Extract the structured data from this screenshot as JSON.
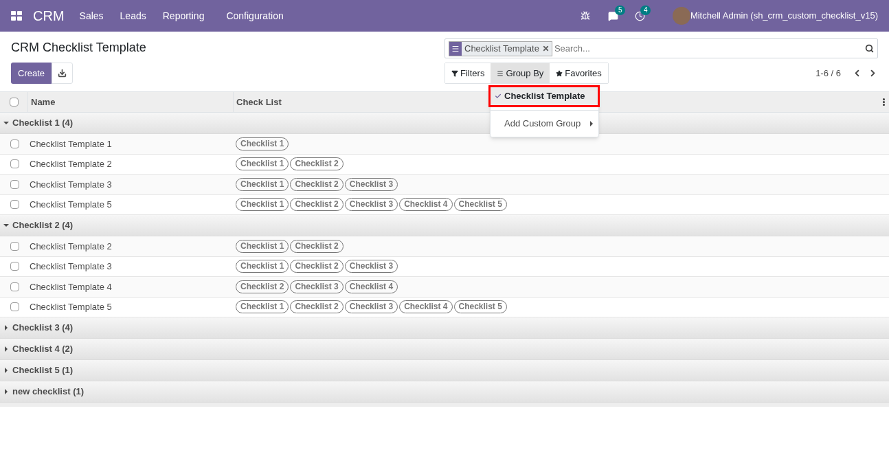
{
  "navbar": {
    "app": "CRM",
    "menus": [
      "Sales",
      "Leads",
      "Reporting",
      "Configuration"
    ],
    "messages_count": "5",
    "activities_count": "4",
    "user": "Mitchell Admin (sh_crm_custom_checklist_v15)"
  },
  "title": "CRM Checklist Template",
  "buttons": {
    "create": "Create"
  },
  "search": {
    "facet": "Checklist Template",
    "placeholder": "Search..."
  },
  "search_options": [
    "Filters",
    "Group By",
    "Favorites"
  ],
  "group_by_menu": {
    "open": true,
    "items": [
      {
        "label": "Checklist Template",
        "selected": true,
        "highlighted": true
      }
    ],
    "custom": "Add Custom Group"
  },
  "pager": "1-6 / 6",
  "table": {
    "all_checked": false,
    "columns": [
      "Name",
      "Check List"
    ],
    "groups": [
      {
        "label": "Checklist 1 (4)",
        "expanded": true,
        "rows": [
          {
            "name": "Checklist Template 1",
            "checked": false,
            "tags": [
              "Checklist 1"
            ]
          },
          {
            "name": "Checklist Template 2",
            "checked": false,
            "tags": [
              "Checklist 1",
              "Checklist 2"
            ]
          },
          {
            "name": "Checklist Template 3",
            "checked": false,
            "tags": [
              "Checklist 1",
              "Checklist 2",
              "Checklist 3"
            ]
          },
          {
            "name": "Checklist Template 5",
            "checked": false,
            "tags": [
              "Checklist 1",
              "Checklist 2",
              "Checklist 3",
              "Checklist 4",
              "Checklist 5"
            ]
          }
        ]
      },
      {
        "label": "Checklist 2 (4)",
        "expanded": true,
        "rows": [
          {
            "name": "Checklist Template 2",
            "checked": false,
            "tags": [
              "Checklist 1",
              "Checklist 2"
            ]
          },
          {
            "name": "Checklist Template 3",
            "checked": false,
            "tags": [
              "Checklist 1",
              "Checklist 2",
              "Checklist 3"
            ]
          },
          {
            "name": "Checklist Template 4",
            "checked": false,
            "tags": [
              "Checklist 2",
              "Checklist 3",
              "Checklist 4"
            ]
          },
          {
            "name": "Checklist Template 5",
            "checked": false,
            "tags": [
              "Checklist 1",
              "Checklist 2",
              "Checklist 3",
              "Checklist 4",
              "Checklist 5"
            ]
          }
        ]
      },
      {
        "label": "Checklist 3 (4)",
        "expanded": false
      },
      {
        "label": "Checklist 4 (2)",
        "expanded": false
      },
      {
        "label": "Checklist 5 (1)",
        "expanded": false
      },
      {
        "label": "new checklist (1)",
        "expanded": false
      }
    ]
  }
}
